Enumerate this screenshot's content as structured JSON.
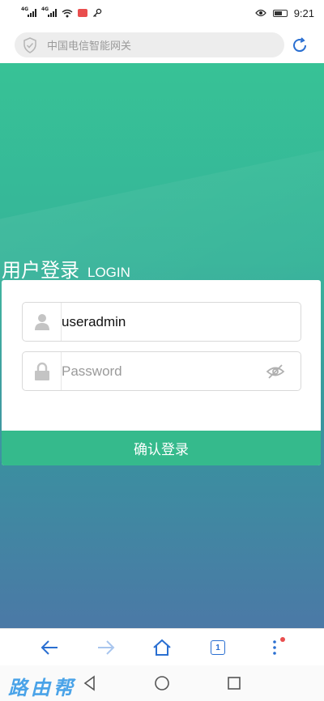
{
  "status_bar": {
    "network_left": "4G",
    "network_right": "4G",
    "time": "9:21"
  },
  "address_bar": {
    "url_text": "中国电信智能网关",
    "security_icon": "shield-check-icon",
    "reload_icon": "reload-icon"
  },
  "login": {
    "title_cn": "用户登录",
    "title_en": "LOGIN",
    "username_value": "useradmin",
    "password_placeholder": "Password",
    "submit_label": "确认登录"
  },
  "toolbar": {
    "tab_count": "1"
  },
  "watermark": {
    "text": "路由帮"
  },
  "colors": {
    "gradient_top": "#37c296",
    "gradient_bottom": "#4b79a6",
    "accent_button": "#35ba8c",
    "browser_blue": "#2a6fd1"
  }
}
